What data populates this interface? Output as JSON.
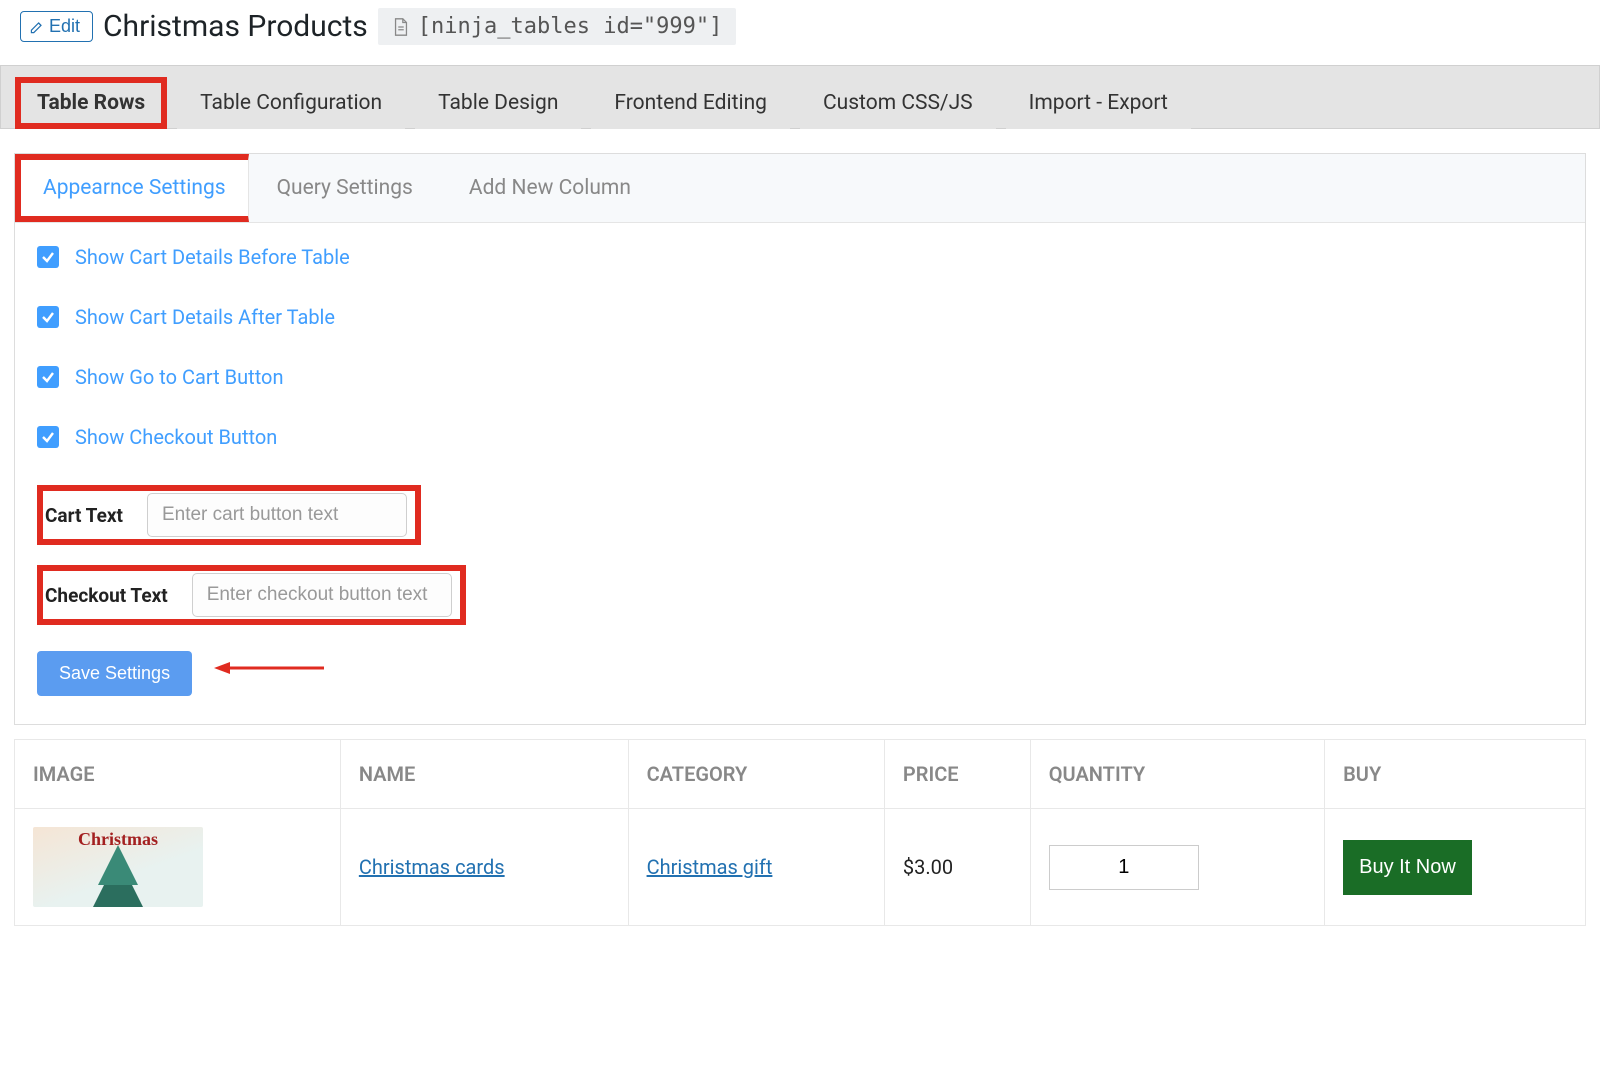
{
  "header": {
    "edit_label": "Edit",
    "title": "Christmas Products",
    "shortcode": "[ninja_tables id=\"999\"]"
  },
  "main_tabs": [
    {
      "label": "Table Rows",
      "active": true
    },
    {
      "label": "Table Configuration",
      "active": false
    },
    {
      "label": "Table Design",
      "active": false
    },
    {
      "label": "Frontend Editing",
      "active": false
    },
    {
      "label": "Custom CSS/JS",
      "active": false
    },
    {
      "label": "Import - Export",
      "active": false
    }
  ],
  "sub_tabs": [
    {
      "label": "Appearnce Settings",
      "active": true
    },
    {
      "label": "Query Settings",
      "active": false
    },
    {
      "label": "Add New Column",
      "active": false
    }
  ],
  "checkboxes": [
    {
      "label": "Show Cart Details Before Table",
      "checked": true
    },
    {
      "label": "Show Cart Details After Table",
      "checked": true
    },
    {
      "label": "Show Go to Cart Button",
      "checked": true
    },
    {
      "label": "Show Checkout Button",
      "checked": true
    }
  ],
  "fields": {
    "cart_text_label": "Cart Text",
    "cart_text_placeholder": "Enter cart button text",
    "checkout_text_label": "Checkout Text",
    "checkout_text_placeholder": "Enter checkout button text"
  },
  "save_label": "Save Settings",
  "table": {
    "headers": [
      "IMAGE",
      "NAME",
      "CATEGORY",
      "PRICE",
      "QUANTITY",
      "BUY"
    ],
    "row": {
      "image_text": "Christmas",
      "name": "Christmas cards",
      "category": "Christmas gift",
      "price": "$3.00",
      "quantity": "1",
      "buy_label": "Buy It Now"
    }
  }
}
